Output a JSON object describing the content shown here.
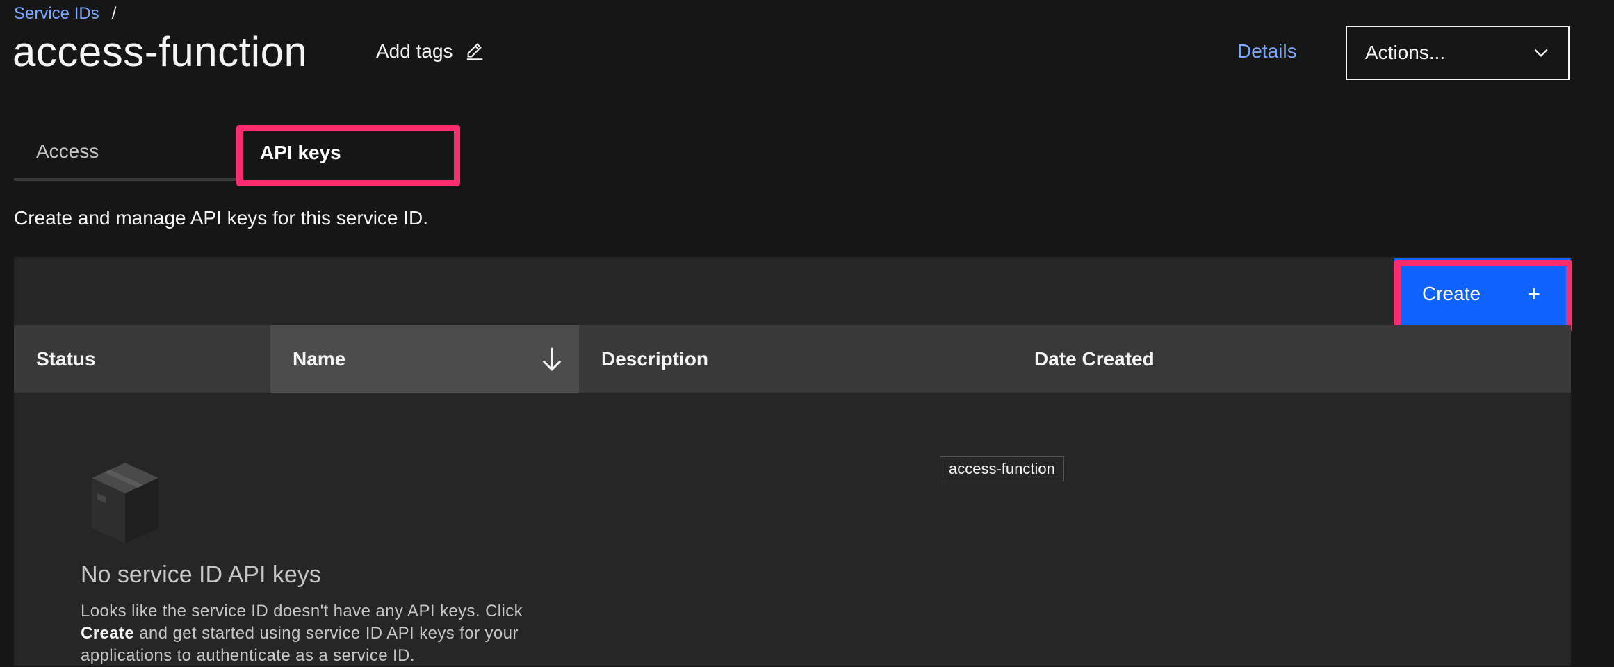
{
  "breadcrumb": {
    "link_label": "Service IDs",
    "separator": "/"
  },
  "page": {
    "title": "access-function",
    "add_tags_label": "Add tags",
    "details_label": "Details",
    "actions_label": "Actions..."
  },
  "tabs": [
    {
      "label": "Access",
      "selected": false
    },
    {
      "label": "API keys",
      "selected": true
    }
  ],
  "intro": "Create and manage API keys for this service ID.",
  "toolbar": {
    "create_label": "Create",
    "create_icon": "+"
  },
  "table": {
    "columns": [
      "Status",
      "Name",
      "Description",
      "Date Created"
    ],
    "sorted_column": "Name",
    "sort_direction": "descending"
  },
  "empty_state": {
    "title": "No service ID API keys",
    "body_pre": "Looks like the service ID doesn't have any API keys. Click",
    "body_bold": "Create",
    "body_post": "and get started using service ID API keys for your applications to authenticate as a service ID."
  },
  "tooltip": "access-function",
  "colors": {
    "background": "#161616",
    "link": "#78a9ff",
    "primary_button": "#0f62fe",
    "highlight": "#ff2d6f",
    "panel": "#262626",
    "header": "#393939"
  },
  "icons": {
    "edit": "pencil-icon",
    "dropdown": "chevron-down-icon",
    "sort": "arrow-down-icon",
    "empty": "box-icon"
  }
}
